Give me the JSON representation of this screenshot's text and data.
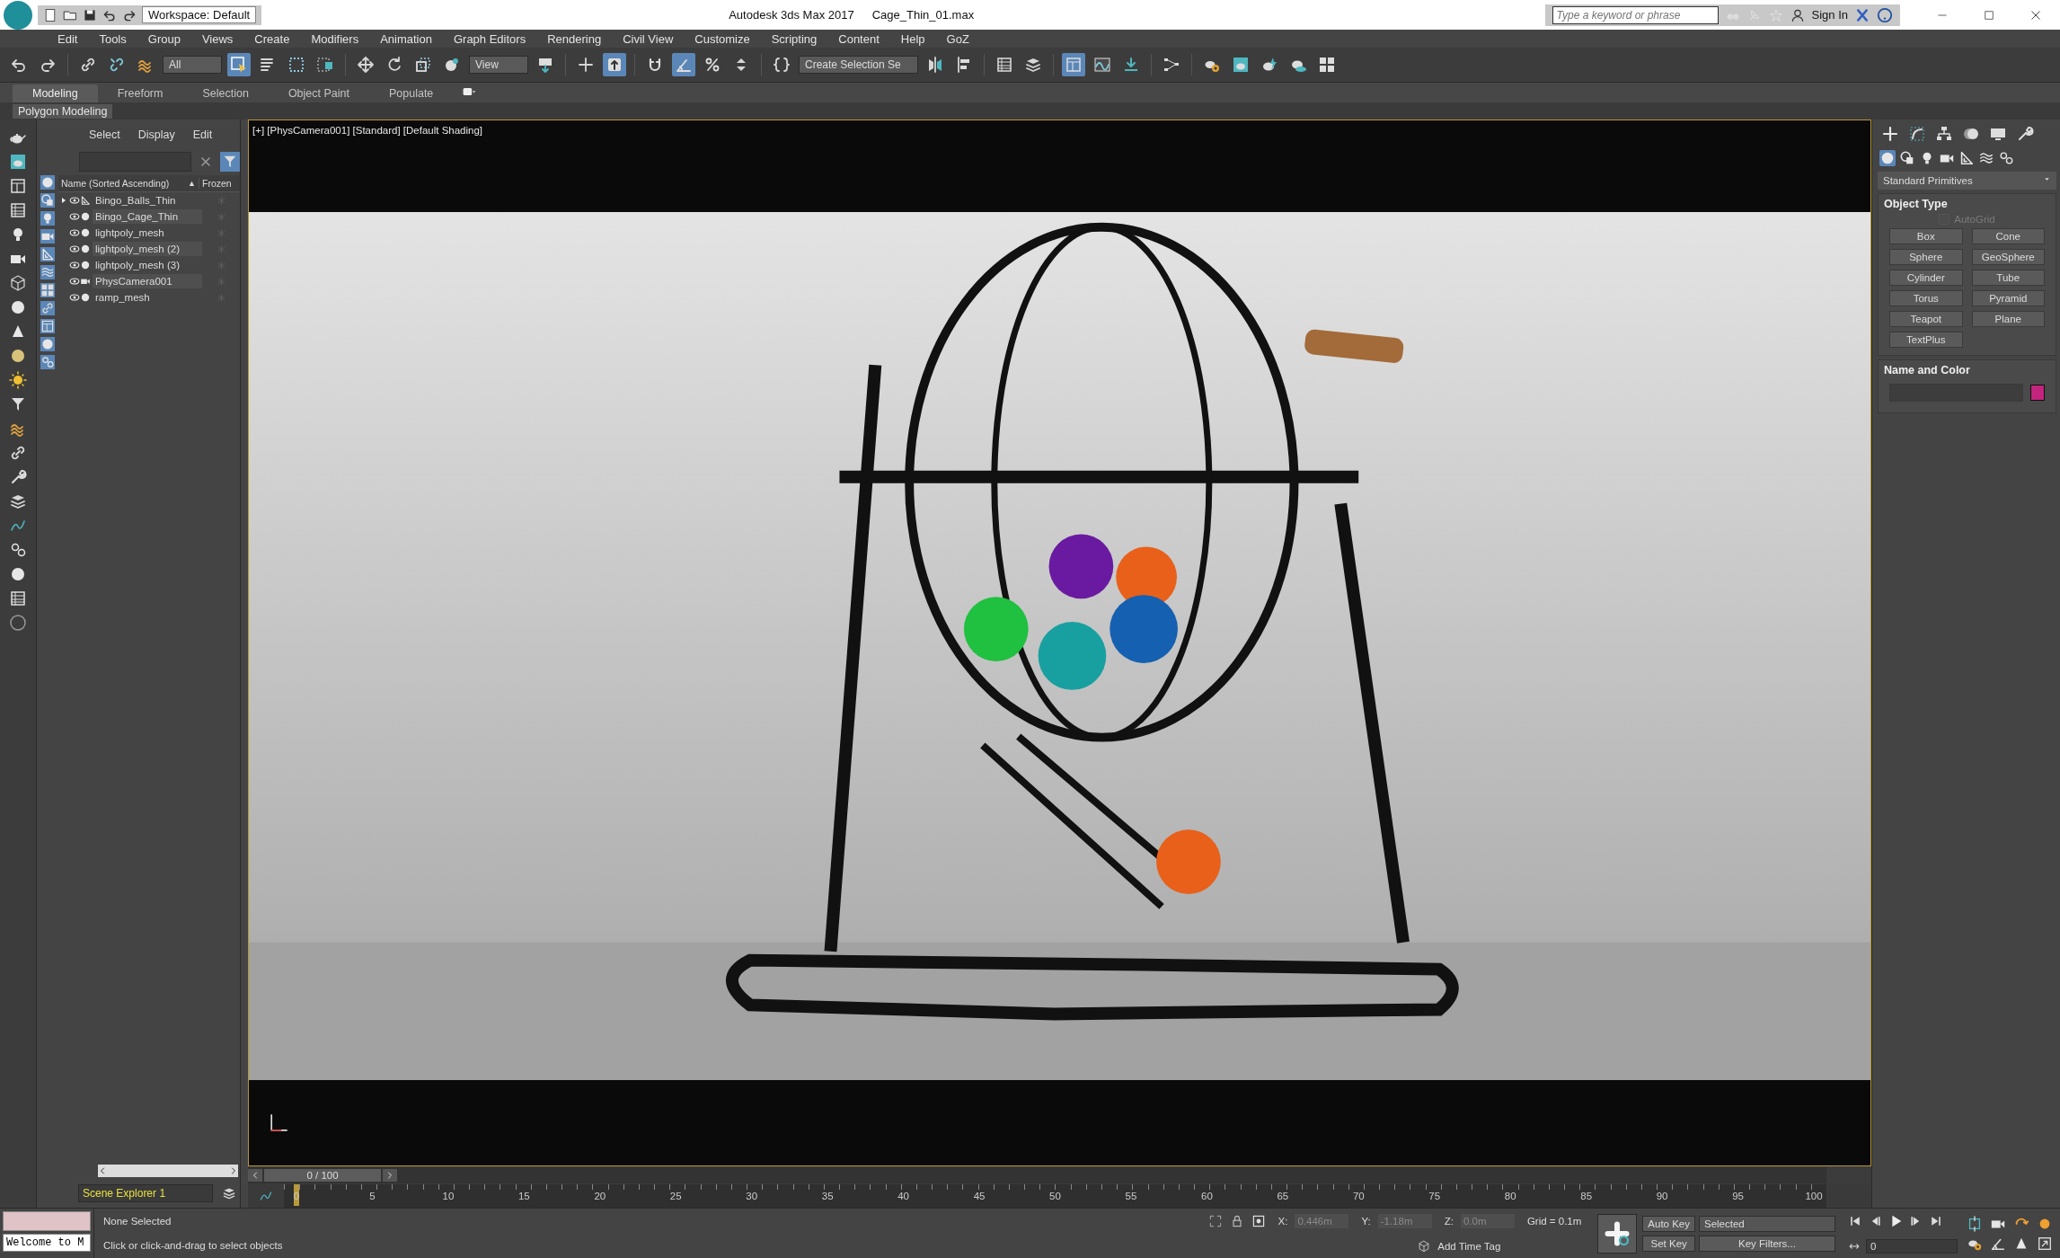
{
  "title_bar": {
    "workspace": "Workspace: Default",
    "app_title": "Autodesk 3ds Max 2017",
    "file_name": "Cage_Thin_01.max",
    "search": {
      "placeholder": "Type a keyword or phrase"
    },
    "sign_in": "Sign In"
  },
  "menu": [
    "Edit",
    "Tools",
    "Group",
    "Views",
    "Create",
    "Modifiers",
    "Animation",
    "Graph Editors",
    "Rendering",
    "Civil View",
    "Customize",
    "Scripting",
    "Content",
    "Help",
    "GoZ"
  ],
  "toolbar": {
    "selection_filter": "All",
    "reference_coord": "View",
    "selection_set": "Create Selection Se"
  },
  "ribbon": {
    "tabs": [
      {
        "label": "Modeling",
        "selected": true
      },
      {
        "label": "Freeform",
        "selected": false
      },
      {
        "label": "Selection",
        "selected": false
      },
      {
        "label": "Object Paint",
        "selected": false
      },
      {
        "label": "Populate",
        "selected": false
      }
    ],
    "panel_label": "Polygon Modeling"
  },
  "scene_explorer": {
    "menu": [
      "Select",
      "Display",
      "Edit"
    ],
    "columns": [
      "Name (Sorted Ascending)",
      "Frozen"
    ],
    "sort_mark": "▲",
    "items": [
      {
        "name": "Bingo_Balls_Thin",
        "kind": "group",
        "expanded": false
      },
      {
        "name": "Bingo_Cage_Thin",
        "kind": "geometry"
      },
      {
        "name": "lightpoly_mesh",
        "kind": "geometry"
      },
      {
        "name": "lightpoly_mesh (2)",
        "kind": "geometry"
      },
      {
        "name": "lightpoly_mesh (3)",
        "kind": "geometry"
      },
      {
        "name": "PhysCamera001",
        "kind": "camera"
      },
      {
        "name": "ramp_mesh",
        "kind": "geometry"
      }
    ],
    "footer": "Scene Explorer 1"
  },
  "viewport": {
    "label": "[+] [PhysCamera001] [Standard] [Default Shading]"
  },
  "timeline": {
    "frame": "0 / 100",
    "level": 0,
    "ticks": [
      "0",
      "5",
      "10",
      "15",
      "20",
      "25",
      "30",
      "35",
      "40",
      "45",
      "50",
      "55",
      "60",
      "65",
      "70",
      "75",
      "80",
      "85",
      "90",
      "95",
      "100"
    ]
  },
  "command_panel": {
    "dropdown": "Standard Primitives",
    "object_type": {
      "title": "Object Type",
      "autogrid": {
        "label": "AutoGrid",
        "checked": false,
        "disabled": true
      },
      "buttons": [
        "Box",
        "Cone",
        "Sphere",
        "GeoSphere",
        "Cylinder",
        "Tube",
        "Torus",
        "Pyramid",
        "Teapot",
        "Plane",
        "TextPlus"
      ]
    },
    "name_and_color": {
      "title": "Name and Color",
      "color": "#c2247e"
    }
  },
  "status_bar": {
    "listener": "Welcome to M",
    "selection": "None Selected",
    "prompt": "Click or click-and-drag to select objects",
    "coords": [
      {
        "label": "X:",
        "value": "0.446m"
      },
      {
        "label": "Y:",
        "value": "-1.18m"
      },
      {
        "label": "Z:",
        "value": "0.0m"
      }
    ],
    "grid": "Grid = 0.1m",
    "add_time_tag": "Add Time Tag",
    "auto_key": "Auto Key",
    "set_key": "Set Key",
    "key_mode": "Selected",
    "key_filters": "Key Filters...",
    "current_frame": "0"
  }
}
